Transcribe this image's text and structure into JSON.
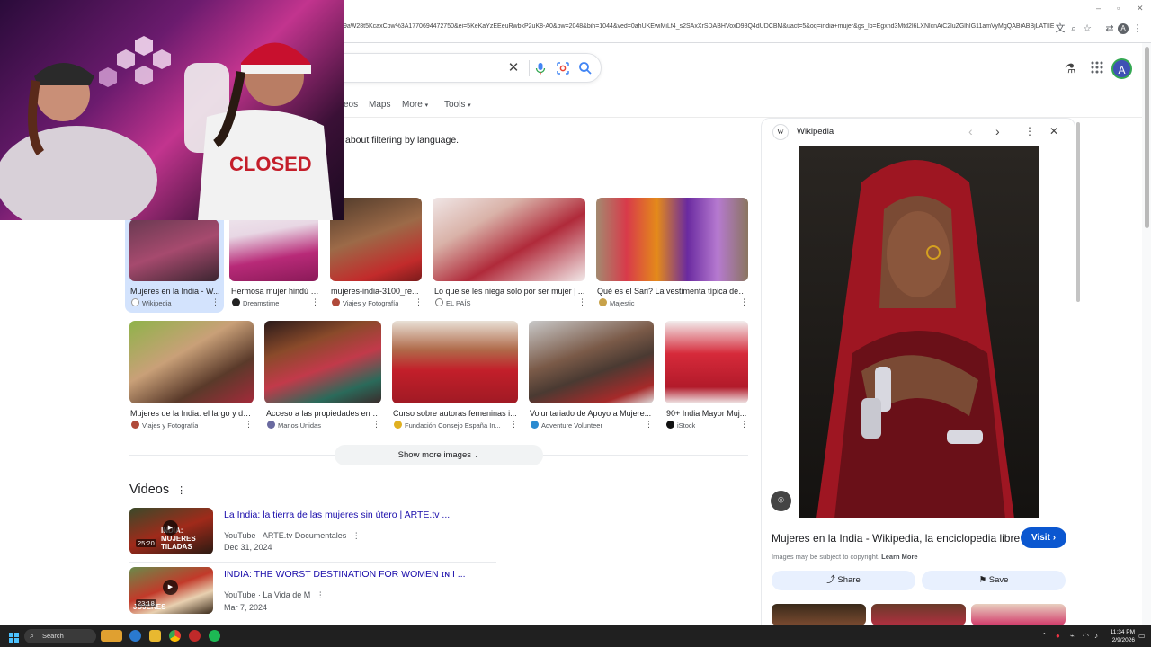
{
  "browser": {
    "url": "9aW28t5KcaxCbw%3A1770694472750&ei=5KeKaYzEEeuRwbkP2uK8-A0&bw=2048&bih=1044&ved=0ahUKEwiMiLf4_s2SAxXrSDABHVoxD98Q4dUDCBM&uact=5&oq=india+mujer&gs_lp=Egxnd3Mtd2l6LXNlcnAiC2luZGlhIG11amVyMgQABiABBjLATIIE...",
    "avatar_letter": "A",
    "window_minimize": "–",
    "window_maximize": "▫",
    "window_close": "✕"
  },
  "tabs": [
    {
      "label": "eos"
    },
    {
      "label": "Maps"
    },
    {
      "label": "More"
    },
    {
      "label": "Tools"
    }
  ],
  "filter_message": "about filtering by language.",
  "images_row1": [
    {
      "caption": "Mujeres en la India - W...",
      "source": "Wikipedia",
      "selected": true
    },
    {
      "caption": "Hermosa mujer hindú i...",
      "source": "Dreamstime"
    },
    {
      "caption": "mujeres-india-3100_re...",
      "source": "Viajes y Fotografía"
    },
    {
      "caption": "Lo que se les niega solo por ser mujer | ...",
      "source": "EL PAÍS"
    },
    {
      "caption": "Qué es el Sari? La vestimenta típica de l...",
      "source": "Majestic"
    }
  ],
  "images_row2": [
    {
      "caption": "Mujeres de la India: el largo y du...",
      "source": "Viajes y Fotografía"
    },
    {
      "caption": "Acceso a las propiedades en Í...",
      "source": "Manos Unidas"
    },
    {
      "caption": "Curso sobre autoras femeninas i...",
      "source": "Fundación Consejo España In..."
    },
    {
      "caption": "Voluntariado de Apoyo a Mujere...",
      "source": "Adventure Volunteer"
    },
    {
      "caption": "90+ India Mayor Muj...",
      "source": "iStock"
    }
  ],
  "show_more": "Show more images",
  "videos": {
    "heading": "Videos",
    "items": [
      {
        "title": "La India: la tierra de las mujeres sin útero | ARTE.tv ...",
        "source": "YouTube · ARTE.tv Documentales",
        "date": "Dec 31, 2024",
        "duration": "25:20",
        "thumb_text": "INDIA: MUJERES TILADAS"
      },
      {
        "title": "INDIA: THE WORST DESTINATION FOR WOMEN ɪɴ I ...",
        "source": "YouTube · La Vida de M",
        "date": "Mar 7, 2024",
        "duration": "23:18",
        "thumb_text": "JUJERES"
      }
    ]
  },
  "panel": {
    "site": "Wikipedia",
    "site_badge": "W",
    "title": "Mujeres en la India - Wikipedia, la enciclopedia libre",
    "visit": "Visit",
    "copyright": "Images may be subject to copyright.",
    "learn_more": "Learn More",
    "share": "Share",
    "save": "Save"
  },
  "webcam_shirt_text": "CLOSED",
  "taskbar": {
    "search": "Search",
    "time": "11:34 PM",
    "date": "2/9/2026"
  },
  "colors": {
    "link": "#1a0dab",
    "visit_button": "#0b57d0",
    "selected_tile": "#d3e3fd",
    "taskbar": "#202020"
  }
}
